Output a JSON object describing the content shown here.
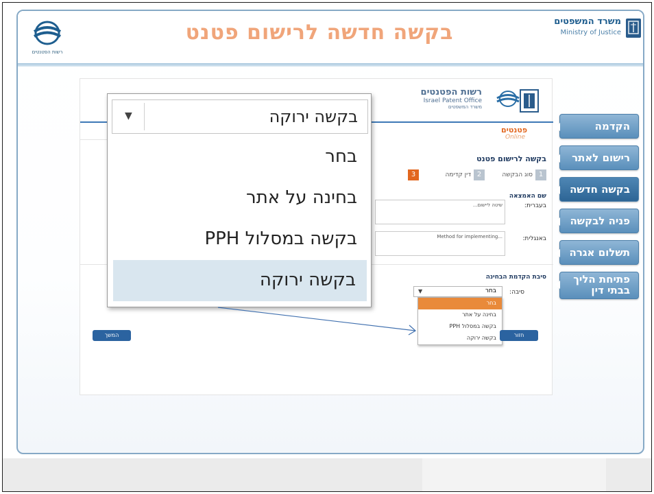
{
  "header": {
    "title": "בקשה חדשה לרישום פטנט",
    "logo_caption": "רשות הפטנטים",
    "ministry_he": "משרד המשפטים",
    "ministry_en": "Ministry of Justice"
  },
  "side_nav": {
    "items": [
      {
        "label": "הקדמה",
        "active": false
      },
      {
        "label": "רישום לאתר",
        "active": false
      },
      {
        "label": "בקשה חדשה",
        "active": true
      },
      {
        "label": "פניה לבקשה",
        "active": false
      },
      {
        "label": "תשלום אגרה",
        "active": false
      },
      {
        "label": "פתיחת הליך בבתי דין",
        "active": false
      }
    ]
  },
  "screenshot": {
    "ipo_name_he": "רשות הפטנטים",
    "ipo_name_en": "Israel Patent Office",
    "ipo_ministry": "משרד המשפטים",
    "patents_logo": "פטנטים",
    "patents_logo_sub": "Online",
    "form_title": "בקשה לרישום פטנט",
    "steps": [
      {
        "num": "1",
        "label": "סוג הבקשה",
        "current": false
      },
      {
        "num": "2",
        "label": "דין קדימה",
        "current": false
      },
      {
        "num": "3",
        "label": "",
        "current": true
      }
    ],
    "invention_name_label": "שם האמצאה",
    "hebrew_label": "בעברית:",
    "hebrew_value": "שיטה ליישום...",
    "english_label": "באנגלית:",
    "english_value": "Method for implementing...",
    "priority_section_label": "סיבת הקדמת הבחינה",
    "reason_label": "סיבה:",
    "select_value": "בחר",
    "options": [
      "בחר",
      "בחינה על אתר",
      "בקשה במסלול PPH",
      "בקשה ירוקה"
    ],
    "prev_button": "המשך",
    "back_button": "חזור"
  },
  "zoom": {
    "selected_value": "בקשה ירוקה",
    "options": [
      "בחר",
      "בחינה על אתר",
      "בקשה במסלול PPH",
      "בקשה ירוקה"
    ],
    "highlighted_index": 3
  },
  "colors": {
    "title_orange": "#f0a57a",
    "nav_blue": "#5a8fbb",
    "nav_active": "#2d6595",
    "frame_border": "#86a9c6",
    "selected_option": "#e98a3a",
    "highlight_option": "#d9e6ef"
  }
}
